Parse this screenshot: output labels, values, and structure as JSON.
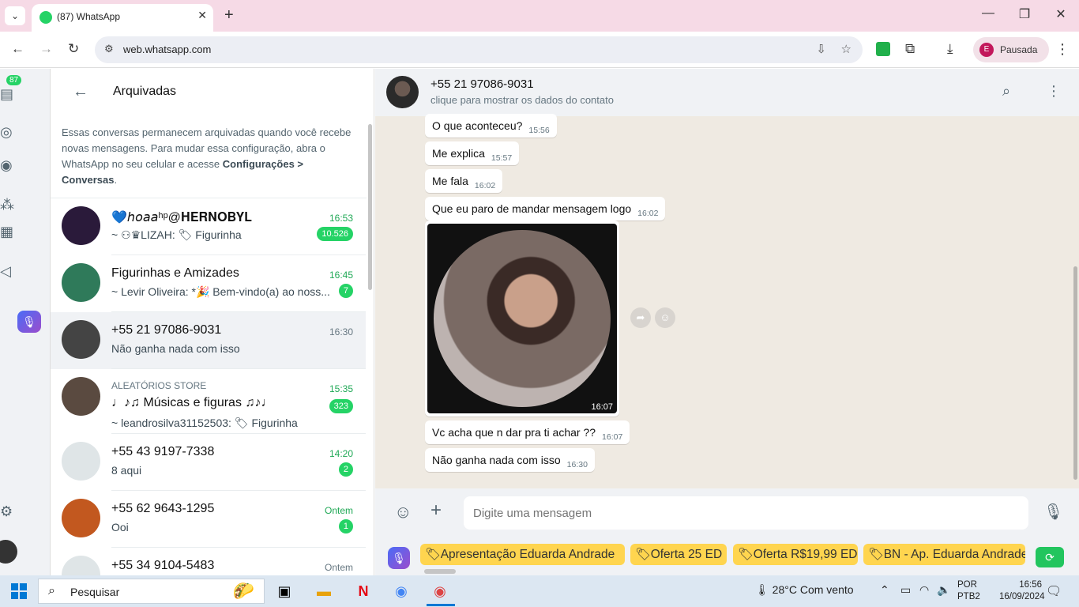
{
  "browser": {
    "tab_title": "(87) WhatsApp",
    "tab_close": "✕",
    "new_tab": "+",
    "url": "web.whatsapp.com",
    "profile_initial": "E",
    "profile_label": "Pausada",
    "window": {
      "minimize": "—",
      "restore": "❐",
      "close": "✕"
    }
  },
  "rail": {
    "badge": "87",
    "mic": "🎙"
  },
  "sidebar": {
    "back": "←",
    "title": "Arquivadas",
    "note_text": "Essas conversas permanecem arquivadas quando você recebe novas mensagens. Para mudar essa configuração, abra o WhatsApp no seu celular e acesse ",
    "note_bold": "Configurações > Conversas",
    "note_end": ".",
    "chats": [
      {
        "name": "💙𝘩𝘰𝘢𝘢ʰᵖ@𝐇𝐄𝐑𝐍𝐎𝐁𝐘𝐋",
        "time": "16:53",
        "preview": "~ ⚇♛LIZAH: 🏷 Figurinha",
        "badge": "10.526",
        "color": "#2a1a3a"
      },
      {
        "name": "Figurinhas e Amizades",
        "time": "16:45",
        "preview": "~ Levir Oliveira: *🎉 Bem-vindo(a) ao noss...",
        "badge": "7",
        "color": "#2f7a5a"
      },
      {
        "name": "+55 21 97086-9031",
        "time": "16:30",
        "preview": "Não ganha nada com isso",
        "badge": "",
        "color": "#444"
      },
      {
        "group": "ALEATÓRIOS STORE",
        "name": "♩♪♫ Músicas e figuras ♫♪♩",
        "time": "15:35",
        "preview": "~ leandrosilva31152503: 🏷 Figurinha",
        "badge": "323",
        "color": "#5a4a40"
      },
      {
        "name": "+55 43 9197-7338",
        "time": "14:20",
        "preview": "8 aqui",
        "badge": "2",
        "color": "#dfe5e7"
      },
      {
        "name": "+55 62 9643-1295",
        "time": "Ontem",
        "preview": "Ooi",
        "badge": "1",
        "color": "#c2581f"
      },
      {
        "name": "+55 34 9104-5483",
        "time": "Ontem",
        "preview": "",
        "badge": "",
        "color": "#dfe5e7"
      }
    ]
  },
  "conversation": {
    "contact": "+55 21 97086-9031",
    "subtitle": "clique para mostrar os dados do contato",
    "messages": [
      {
        "text": "O que aconteceu?",
        "time": "15:56"
      },
      {
        "text": "Me explica",
        "time": "15:57"
      },
      {
        "text": "Me fala",
        "time": "16:02"
      },
      {
        "text": "Que eu paro de mandar mensagem logo",
        "time": "16:02"
      },
      {
        "text": "Vc acha que n dar pra ti achar ??",
        "time": "16:07"
      },
      {
        "text": "Não ganha nada com isso",
        "time": "16:30"
      }
    ],
    "image_time": "16:07",
    "composer_placeholder": "Digite uma mensagem"
  },
  "quick_replies": [
    "Apresentação Eduarda Andrade",
    "Oferta 25 ED",
    "Oferta R$19,99 ED",
    "BN - Ap. Eduarda Andrade"
  ],
  "taskbar": {
    "search_placeholder": "Pesquisar",
    "weather": "28°C  Com vento",
    "lang_1": "POR",
    "lang_2": "PTB2",
    "time": "16:56",
    "date": "16/09/2024"
  }
}
